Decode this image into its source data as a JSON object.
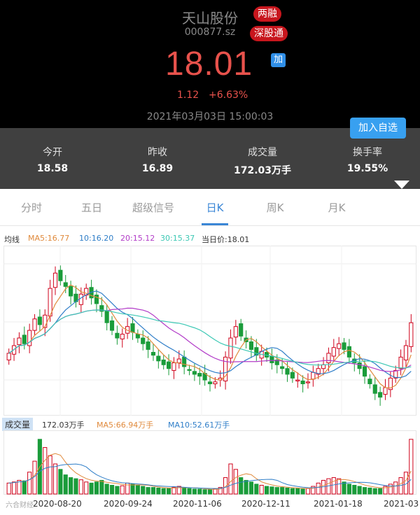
{
  "stock": {
    "name": "天山股份",
    "code": "000877.sz",
    "tag1": "两融",
    "tag2": "深股通",
    "price": "18.01",
    "add_small": "加",
    "change": "1.12",
    "change_pct": "+6.63%",
    "datetime": "2021年03月03日 15:00:03",
    "watch_button": "加入自选"
  },
  "stats": [
    {
      "key": "今开",
      "val": "18.58"
    },
    {
      "key": "昨收",
      "val": "16.89"
    },
    {
      "key": "成交量",
      "val": "172.03万手"
    },
    {
      "key": "换手率",
      "val": "19.55%"
    }
  ],
  "tabs": [
    "分时",
    "五日",
    "超级信号",
    "日K",
    "周K",
    "月K"
  ],
  "active_tab": "日K",
  "ma": {
    "label": "均线",
    "ma5": "MA5:16.77",
    "ma10": "10:16.20",
    "ma20": "20:15.12",
    "ma30": "30:15.37",
    "current": "当日价:18.01"
  },
  "volume": {
    "label": "成交量",
    "total": "172.03万手",
    "ma5": "MA5:66.94万手",
    "ma10": "MA10:52.61万手"
  },
  "colors": {
    "up": "#d0021b",
    "down": "#1a9c3a",
    "ma5": "#e08a3c",
    "ma10": "#2f7ec8",
    "ma20": "#b23cc8",
    "ma30": "#3cc8b4"
  },
  "watermark": "六合财经",
  "chart_data": {
    "type": "candlestick",
    "x_labels": [
      "2020-08-20",
      "2020-09-24",
      "2020-11-06",
      "2020-12-11",
      "2021-01-18",
      "2021-03"
    ],
    "close_series": [
      13.4,
      13.8,
      14.2,
      13.9,
      14.6,
      15.2,
      14.9,
      15.4,
      16.8,
      17.6,
      17.2,
      16.9,
      16.4,
      16.1,
      16.5,
      16.8,
      16.3,
      16.0,
      15.6,
      15.0,
      14.6,
      14.2,
      14.4,
      14.8,
      14.5,
      14.2,
      13.9,
      13.6,
      13.3,
      13.0,
      12.8,
      12.6,
      12.9,
      13.1,
      12.7,
      12.5,
      12.3,
      12.2,
      12.0,
      11.8,
      11.9,
      12.1,
      13.2,
      14.2,
      14.8,
      14.3,
      14.0,
      13.6,
      13.3,
      13.5,
      13.2,
      12.9,
      12.8,
      12.6,
      12.3,
      12.1,
      12.0,
      11.8,
      11.9,
      12.4,
      12.6,
      12.8,
      13.4,
      13.7,
      13.9,
      13.6,
      13.2,
      12.9,
      12.6,
      12.2,
      11.8,
      11.3,
      11.1,
      11.6,
      12.1,
      12.5,
      13.2,
      13.8,
      15.0
    ],
    "volume_series": [
      20,
      22,
      25,
      24,
      40,
      60,
      100,
      85,
      70,
      55,
      45,
      35,
      30,
      28,
      26,
      22,
      20,
      22,
      25,
      18,
      16,
      14,
      15,
      20,
      18,
      16,
      14,
      12,
      12,
      11,
      10,
      10,
      12,
      14,
      12,
      10,
      9,
      9,
      8,
      8,
      9,
      12,
      30,
      55,
      45,
      30,
      25,
      22,
      18,
      16,
      14,
      13,
      12,
      12,
      11,
      10,
      10,
      9,
      10,
      14,
      20,
      25,
      28,
      30,
      28,
      22,
      18,
      16,
      14,
      12,
      11,
      10,
      10,
      14,
      18,
      22,
      30,
      40,
      100
    ]
  }
}
